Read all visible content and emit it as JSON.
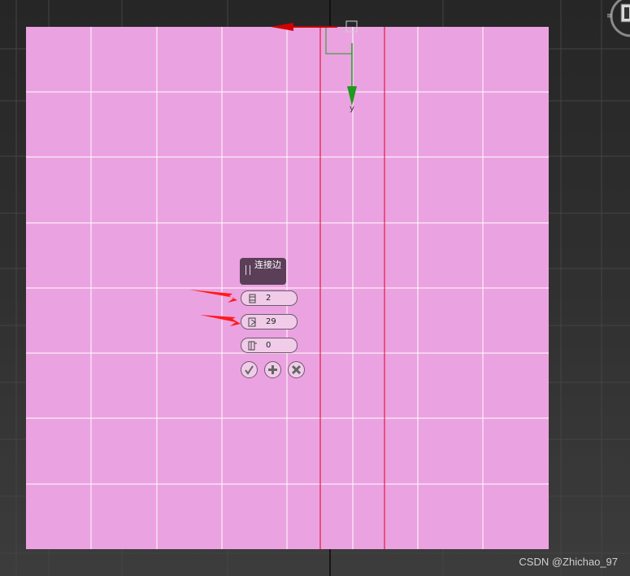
{
  "caddy": {
    "title": "连接边",
    "fields": [
      {
        "icon": "segments-icon",
        "value": "2"
      },
      {
        "icon": "pinch-icon",
        "value": "29"
      },
      {
        "icon": "slide-icon",
        "value": "0"
      }
    ],
    "buttons": [
      "ok-check-icon",
      "apply-plus-icon",
      "cancel-x-icon"
    ]
  },
  "gizmo": {
    "y_label": "y"
  },
  "watermark": "CSDN @Zhichao_97",
  "colors": {
    "plane": "#eba2e0",
    "grid_line": "#ffffff",
    "edge_selected": "#e0001a",
    "caddy_title_bg": "#5b3e58",
    "annotation_arrow": "#ff1a1a",
    "gizmo_y": "#1e9a1e",
    "gizmo_x": "#d40000"
  }
}
